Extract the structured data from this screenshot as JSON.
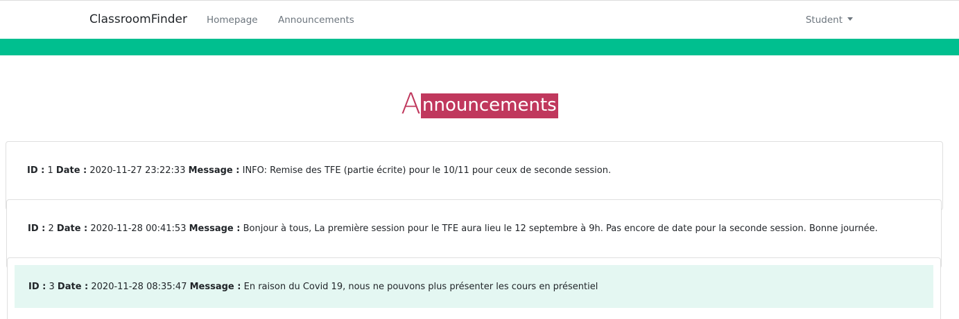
{
  "navbar": {
    "brand": "ClassroomFinder",
    "links": [
      {
        "label": "Homepage"
      },
      {
        "label": "Announcements"
      }
    ],
    "user_menu": "Student"
  },
  "colors": {
    "accent_bar": "#00bf8f",
    "heading_accent": "#c0385d",
    "highlight_row": "#e4f7f2"
  },
  "heading": {
    "first_letter": "A",
    "rest": "nnouncements"
  },
  "labels": {
    "id": "ID :",
    "date": "Date :",
    "message": "Message :"
  },
  "announcements": [
    {
      "id": "1",
      "date": "2020-11-27 23:22:33",
      "message": "INFO: Remise des TFE (partie écrite) pour le 10/11 pour ceux de seconde session."
    },
    {
      "id": "2",
      "date": "2020-11-28 00:41:53",
      "message": "Bonjour à tous, La première session pour le TFE aura lieu le 12 septembre à 9h. Pas encore de date pour la seconde session. Bonne journée."
    },
    {
      "id": "3",
      "date": "2020-11-28 08:35:47",
      "message": "En raison du Covid 19, nous ne pouvons plus présenter les cours en présentiel"
    }
  ]
}
